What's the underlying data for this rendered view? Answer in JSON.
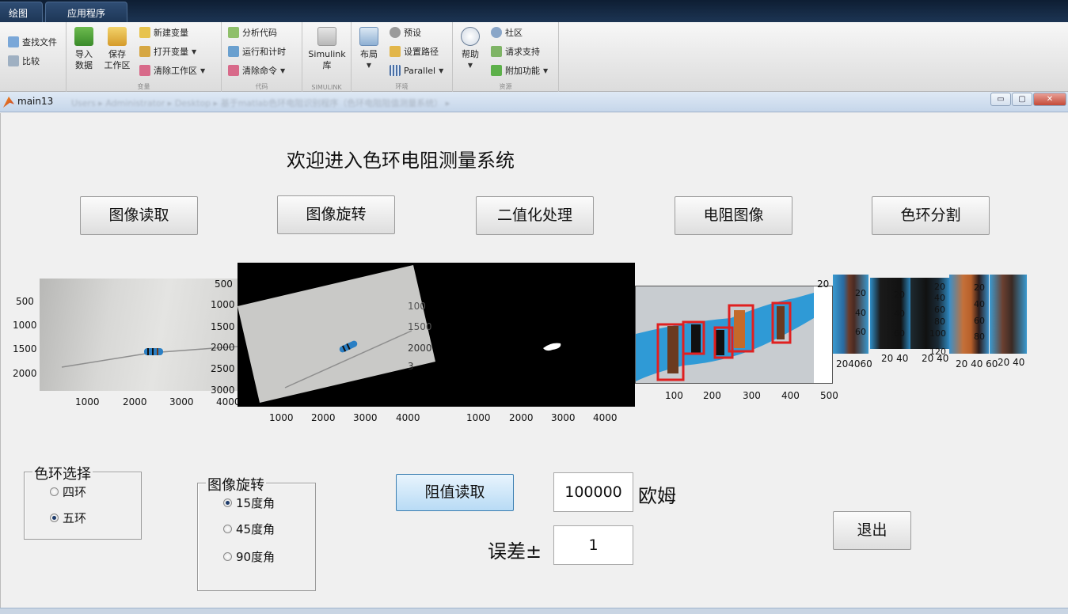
{
  "tabs": [
    "绘图",
    "应用程序"
  ],
  "ribbon": {
    "file": {
      "find_files": "查找文件",
      "compare": "比较"
    },
    "variable": {
      "import_data": [
        "导入",
        "数据"
      ],
      "save_workspace": [
        "保存",
        "工作区"
      ],
      "new_variable": "新建变量",
      "open_variable": "打开变量",
      "clear_workspace": "清除工作区",
      "label": "变量"
    },
    "code": {
      "analyze": "分析代码",
      "run_time": "运行和计时",
      "clear_commands": "清除命令",
      "label": "代码"
    },
    "simulink": {
      "library": [
        "Simulink",
        "库"
      ],
      "label": "SIMULINK"
    },
    "environment": {
      "layout": "布局",
      "preferences": "预设",
      "set_path": "设置路径",
      "parallel": "Parallel",
      "label": "环境"
    },
    "resources": {
      "help": "帮助",
      "community": "社区",
      "request_support": "请求支持",
      "addons": "附加功能",
      "label": "资源"
    }
  },
  "window": {
    "title": "main13",
    "path": "Users ▸ Administrator ▸ Desktop ▸ 基于matlab色环电阻识别程序（色环电阻阻值测量系统） ▸"
  },
  "app": {
    "heading": "欢迎进入色环电阻测量系统",
    "buttons": {
      "read_image": "图像读取",
      "rotate_image": "图像旋转",
      "binarize": "二值化处理",
      "resistor_image": "电阻图像",
      "ring_segment": "色环分割",
      "read_value": "阻值读取",
      "exit": "退出"
    },
    "ring_panel": {
      "title": "色环选择",
      "options": [
        "四环",
        "五环"
      ],
      "selected": "五环"
    },
    "rotate_panel": {
      "title": "图像旋转",
      "options": [
        "15度角",
        "45度角",
        "90度角"
      ],
      "selected": "15度角"
    },
    "resistance_value": "100000",
    "resistance_unit": "欧姆",
    "tolerance_label": "误差±",
    "tolerance_value": "1"
  },
  "axes": {
    "ax1": {
      "y": [
        "500",
        "1000",
        "1500",
        "2000"
      ],
      "x": [
        "1000",
        "2000",
        "3000",
        "4000"
      ]
    },
    "ax2": {
      "y": [
        "500",
        "1000",
        "1500",
        "2000",
        "2500",
        "3000"
      ],
      "y_hidden": [
        "100",
        "1500",
        "2000",
        "3"
      ],
      "x": [
        "1000",
        "2000",
        "3000",
        "4000"
      ]
    },
    "ax3": {
      "x": [
        "1000",
        "2000",
        "3000",
        "4000"
      ]
    },
    "ax4": {
      "x": [
        "100",
        "200",
        "300",
        "400",
        "500"
      ],
      "y_top": "20"
    },
    "seg": {
      "s1": {
        "y": [
          "20",
          "40",
          "60"
        ],
        "x": "204060"
      },
      "s2": {
        "y": [
          "20",
          "40",
          "60"
        ],
        "x": "20 40"
      },
      "s3": {
        "y": [
          "20",
          "40",
          "60",
          "80",
          "100",
          "120"
        ],
        "x": "20 40"
      },
      "s4": {
        "y": [
          "20",
          "40",
          "60",
          "80"
        ],
        "x": "20 40 60"
      },
      "s5": {
        "x": "20 40"
      }
    }
  },
  "colors": {
    "resistor_blue": "#2f9ad6",
    "selection_red": "#e02020",
    "titlebar": "#c6d6ea",
    "active_button": "#b8dbf5"
  }
}
